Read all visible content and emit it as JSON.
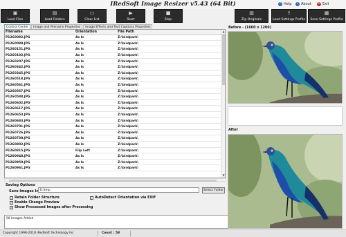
{
  "title": "IRedSoft Image Resizer v5.43 (64 Bit)",
  "titlebar_buttons": [
    "Help",
    "About",
    "Exit"
  ],
  "toolbar": {
    "load_files": "Load Files",
    "load_folders": "Load Folders",
    "clear_list": "Clear List",
    "start": "Start",
    "stop": "Stop",
    "zip_originals": "Zip Originals",
    "load_settings_profile": "Load Settings Profile",
    "save_settings_profile": "Save Settings Profile"
  },
  "tabs": [
    "Control Center",
    "Image and Filename Properties",
    "Image Effects and Text Captions Properties"
  ],
  "table": {
    "headers": [
      "Filename",
      "Orientation",
      "File Path"
    ],
    "rows": [
      [
        "P1260092.JPG",
        "As Is",
        "Z:\\birdpark\\"
      ],
      [
        "P1260088.JPG",
        "As Is",
        "Z:\\birdpark\\"
      ],
      [
        "P1260151.JPG",
        "As Is",
        "Z:\\birdpark\\"
      ],
      [
        "P1260192.JPG",
        "As Is",
        "Z:\\birdpark\\"
      ],
      [
        "P1260207.JPG",
        "As Is",
        "Z:\\birdpark\\"
      ],
      [
        "P1260342.JPG",
        "As Is",
        "Z:\\birdpark\\"
      ],
      [
        "P1260345.JPG",
        "As Is",
        "Z:\\birdpark\\"
      ],
      [
        "P1260518.JPG",
        "As Is",
        "Z:\\birdpark\\"
      ],
      [
        "P1260561.JPG",
        "As Is",
        "Z:\\birdpark\\"
      ],
      [
        "P1260567.JPG",
        "As Is",
        "Z:\\birdpark\\"
      ],
      [
        "P1260588.JPG",
        "As Is",
        "Z:\\birdpark\\"
      ],
      [
        "P1260602.JPG",
        "As Is",
        "Z:\\birdpark\\"
      ],
      [
        "P1260617.JPG",
        "As Is",
        "Z:\\birdpark\\"
      ],
      [
        "P1260653.JPG",
        "As Is",
        "Z:\\birdpark\\"
      ],
      [
        "P1260683.JPG",
        "As Is",
        "Z:\\birdpark\\"
      ],
      [
        "P1260701.JPG",
        "As Is",
        "Z:\\birdpark\\"
      ],
      [
        "P1260726.JPG",
        "As Is",
        "Z:\\birdpark\\"
      ],
      [
        "P1260738.JPG",
        "As Is",
        "Z:\\birdpark\\"
      ],
      [
        "P1260802.JPG",
        "As Is",
        "Z:\\birdpark\\"
      ],
      [
        "P1260815.JPG",
        "Flip Left",
        "Z:\\birdpark\\"
      ],
      [
        "P1260948.JPG",
        "As Is",
        "Z:\\birdpark\\"
      ],
      [
        "P1260950.JPG",
        "As Is",
        "Z:\\birdpark\\"
      ],
      [
        "P1260961.JPG",
        "As Is",
        "Z:\\birdpark\\"
      ]
    ]
  },
  "saving_options": {
    "label": "Saving Options",
    "save_in_label": "Save Images In",
    "save_path": "E:\\tmp",
    "select_folder": "Select Folder",
    "retain_folder": "Retain Folder Structure",
    "enable_preview": "Enable Change Preview",
    "show_processed": "Show Processed Images after Processing",
    "autodetect": "AutoDetect Orientation via EXIF"
  },
  "log_text": "58 Images Added",
  "status": {
    "copyright": "Copyright 1998-2018 iRedSoft Technology Inc",
    "count": "Count : 58"
  },
  "preview": {
    "before_label": "Before - (1600 x 1200)",
    "after_label": "After"
  },
  "colors": {
    "toolbar_bg": "#2b2b2b",
    "help_icon": "#2f6fb0",
    "about_icon": "#2f6fb0",
    "exit_icon": "#c03030",
    "accent": "#1f7a33"
  },
  "icons": {
    "load_files": "image-icon",
    "load_folders": "folder-icon",
    "clear_list": "clear-icon",
    "start": "play-icon",
    "stop": "stop-icon",
    "zip_originals": "zip-icon",
    "load_settings": "open-icon",
    "save_settings": "save-icon"
  }
}
